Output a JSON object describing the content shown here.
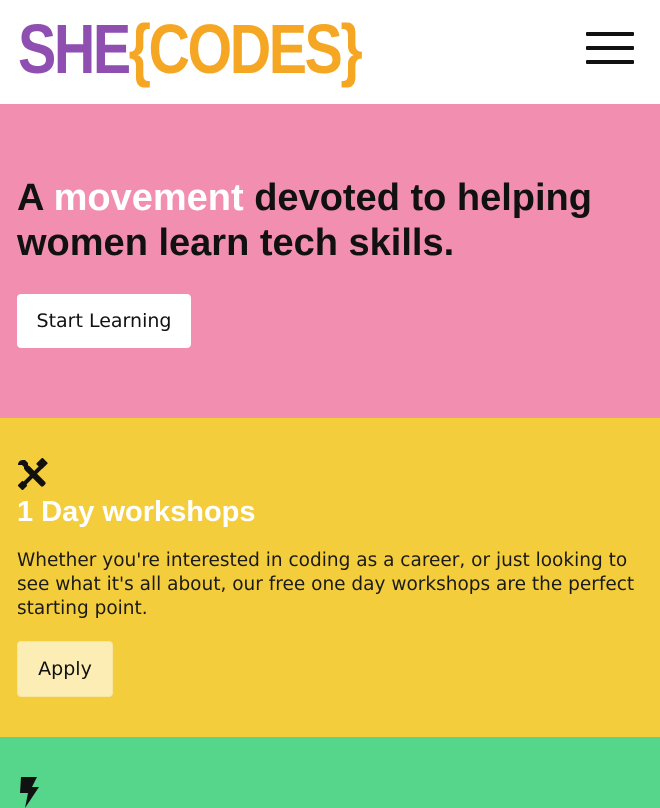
{
  "header": {
    "logo_she": "SHE",
    "logo_codes": "{CODES}",
    "menu_icon": "hamburger-menu-icon"
  },
  "hero": {
    "title_prefix": "A ",
    "title_highlight": "movement",
    "title_suffix": " devoted to helping women learn tech skills.",
    "cta_label": "Start Learning"
  },
  "workshops": {
    "icon": "tools-icon",
    "title": "1 Day workshops",
    "description": "Whether you're interested in coding as a career, or just looking to see what it's all about, our free one day workshops are the perfect starting point.",
    "cta_label": "Apply"
  },
  "next_section": {
    "icon": "lightning-bolt-icon"
  },
  "colors": {
    "brand_purple": "#8e4fb0",
    "brand_orange": "#f5a623",
    "hero_bg": "#f28fb0",
    "workshops_bg": "#f4cd3d",
    "next_bg": "#55d68a"
  }
}
